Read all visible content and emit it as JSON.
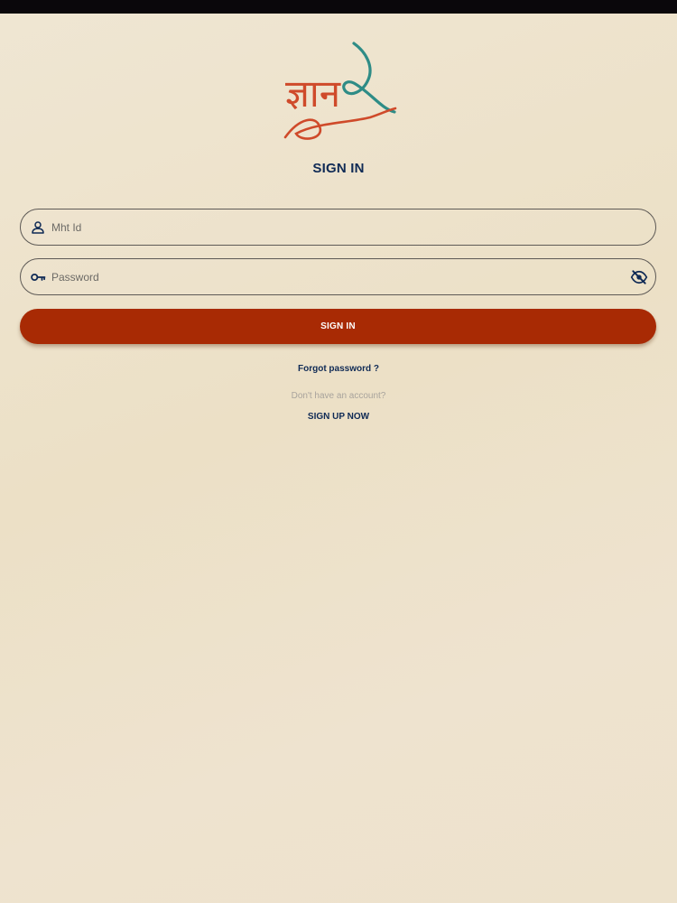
{
  "status_bar": {},
  "logo": {
    "icon": "gnan-logo",
    "text": "ज्ञान",
    "colors": {
      "text": "#cf4a2a",
      "flourish": "#2e8c86"
    }
  },
  "page": {
    "title": "SIGN IN"
  },
  "form": {
    "mht_id": {
      "placeholder": "Mht Id",
      "value": "",
      "icon": "person-icon"
    },
    "password": {
      "placeholder": "Password",
      "value": "",
      "icon": "key-icon",
      "toggle_icon": "eye-off-icon"
    },
    "submit_label": "SIGN IN"
  },
  "links": {
    "forgot_password": "Forgot password ?",
    "no_account_text": "Don't have an account?",
    "signup": "SIGN UP NOW"
  },
  "colors": {
    "accent": "#a82a04",
    "heading": "#0f2a55",
    "background": "#ece2cc"
  }
}
